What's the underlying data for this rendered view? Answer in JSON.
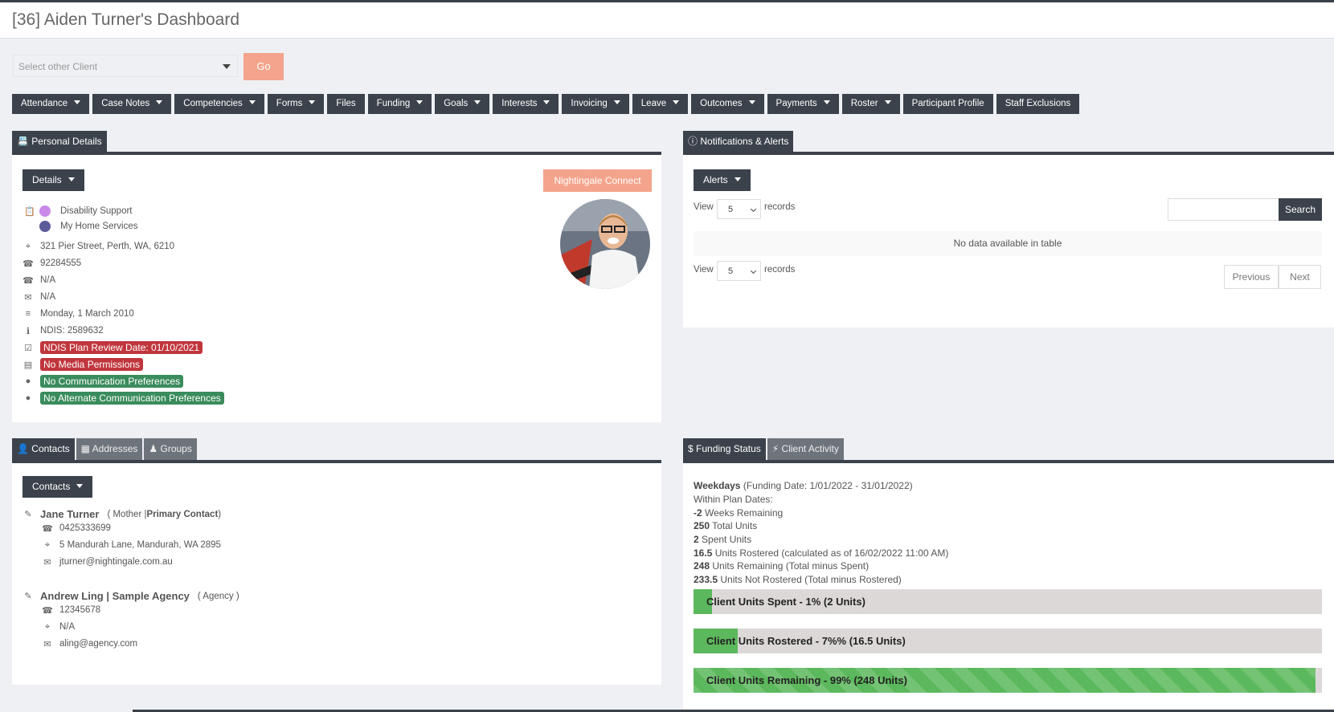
{
  "header": {
    "title": "[36] Aiden Turner's Dashboard"
  },
  "client_select": {
    "placeholder": "Select other Client",
    "go_label": "Go"
  },
  "menu": [
    {
      "label": "Attendance",
      "dropdown": true
    },
    {
      "label": "Case Notes",
      "dropdown": true
    },
    {
      "label": "Competencies",
      "dropdown": true
    },
    {
      "label": "Forms",
      "dropdown": true
    },
    {
      "label": "Files",
      "dropdown": false
    },
    {
      "label": "Funding",
      "dropdown": true
    },
    {
      "label": "Goals",
      "dropdown": true
    },
    {
      "label": "Interests",
      "dropdown": true
    },
    {
      "label": "Invoicing",
      "dropdown": true
    },
    {
      "label": "Leave",
      "dropdown": true
    },
    {
      "label": "Outcomes",
      "dropdown": true
    },
    {
      "label": "Payments",
      "dropdown": true
    },
    {
      "label": "Roster",
      "dropdown": true
    },
    {
      "label": "Participant Profile",
      "dropdown": false
    },
    {
      "label": "Staff Exclusions",
      "dropdown": false
    }
  ],
  "personal": {
    "tab": "Personal Details",
    "details_btn": "Details",
    "nightingale_btn": "Nightingale Connect",
    "services": [
      {
        "label": "Disability Support",
        "color": "#c989e8"
      },
      {
        "label": "My Home Services",
        "color": "#5b5a9a"
      }
    ],
    "address": "321 Pier Street, Perth, WA, 6210",
    "phone": "92284555",
    "mobile": "N/A",
    "email": "N/A",
    "dob": "Monday, 1 March 2010",
    "ndis": "NDIS: 2589632",
    "badges": [
      {
        "text": "NDIS Plan Review Date: 01/10/2021",
        "color": "red",
        "icon": "calendar-check-icon"
      },
      {
        "text": "No Media Permissions",
        "color": "red",
        "icon": "id-card-icon"
      },
      {
        "text": "No Communication Preferences",
        "color": "green",
        "icon": "comment-icon"
      },
      {
        "text": "No Alternate Communication Preferences",
        "color": "green",
        "icon": "comment-icon"
      }
    ]
  },
  "notifications": {
    "tab": "Notifications & Alerts",
    "alerts_btn": "Alerts",
    "view_label": "View",
    "records_label": "records",
    "view_value": "5",
    "search_label": "Search",
    "empty_text": "No data available in table",
    "prev_label": "Previous",
    "next_label": "Next"
  },
  "contacts_panel": {
    "tabs": [
      "Contacts",
      "Addresses",
      "Groups"
    ],
    "contacts_btn": "Contacts",
    "contacts": [
      {
        "name": "Jane Turner",
        "relation_open": "( Mother | ",
        "primary": "Primary Contact",
        "relation_close": " )",
        "phone": "0425333699",
        "address": "5 Mandurah Lane, Mandurah, WA 2895",
        "email": "jturner@nightingale.com.au"
      },
      {
        "name": "Andrew Ling | Sample Agency",
        "relation_open": "( Agency )",
        "primary": "",
        "relation_close": "",
        "phone": "12345678",
        "address": "N/A",
        "email": "aling@agency.com"
      }
    ]
  },
  "funding": {
    "tabs": [
      "Funding Status",
      "Client Activity"
    ],
    "title": "Weekdays",
    "date_range": "(Funding Date: 1/01/2022 - 31/01/2022)",
    "within_plan": "Within Plan Dates:",
    "weeks": {
      "value": "-2",
      "text": "Weeks Remaining"
    },
    "total": {
      "value": "250",
      "text": "Total Units"
    },
    "spent": {
      "value": "2",
      "text": "Spent Units"
    },
    "rostered": {
      "value": "16.5",
      "text": "Units Rostered (calculated as of 16/02/2022 11:00 AM)"
    },
    "remaining": {
      "value": "248",
      "text": "Units Remaining (Total minus Spent)"
    },
    "not_rostered": {
      "value": "233.5",
      "text": "Units Not Rostered (Total minus Rostered)"
    },
    "bars": [
      {
        "label": "Client Units Spent - 1% (2 Units)",
        "fraction": 0.01
      },
      {
        "label": "Client Units Rostered - 7%% (16.5 Units)",
        "fraction": 0.07
      },
      {
        "label": "Client Units Remaining - 99% (248 Units)",
        "fraction": 0.99
      }
    ]
  }
}
